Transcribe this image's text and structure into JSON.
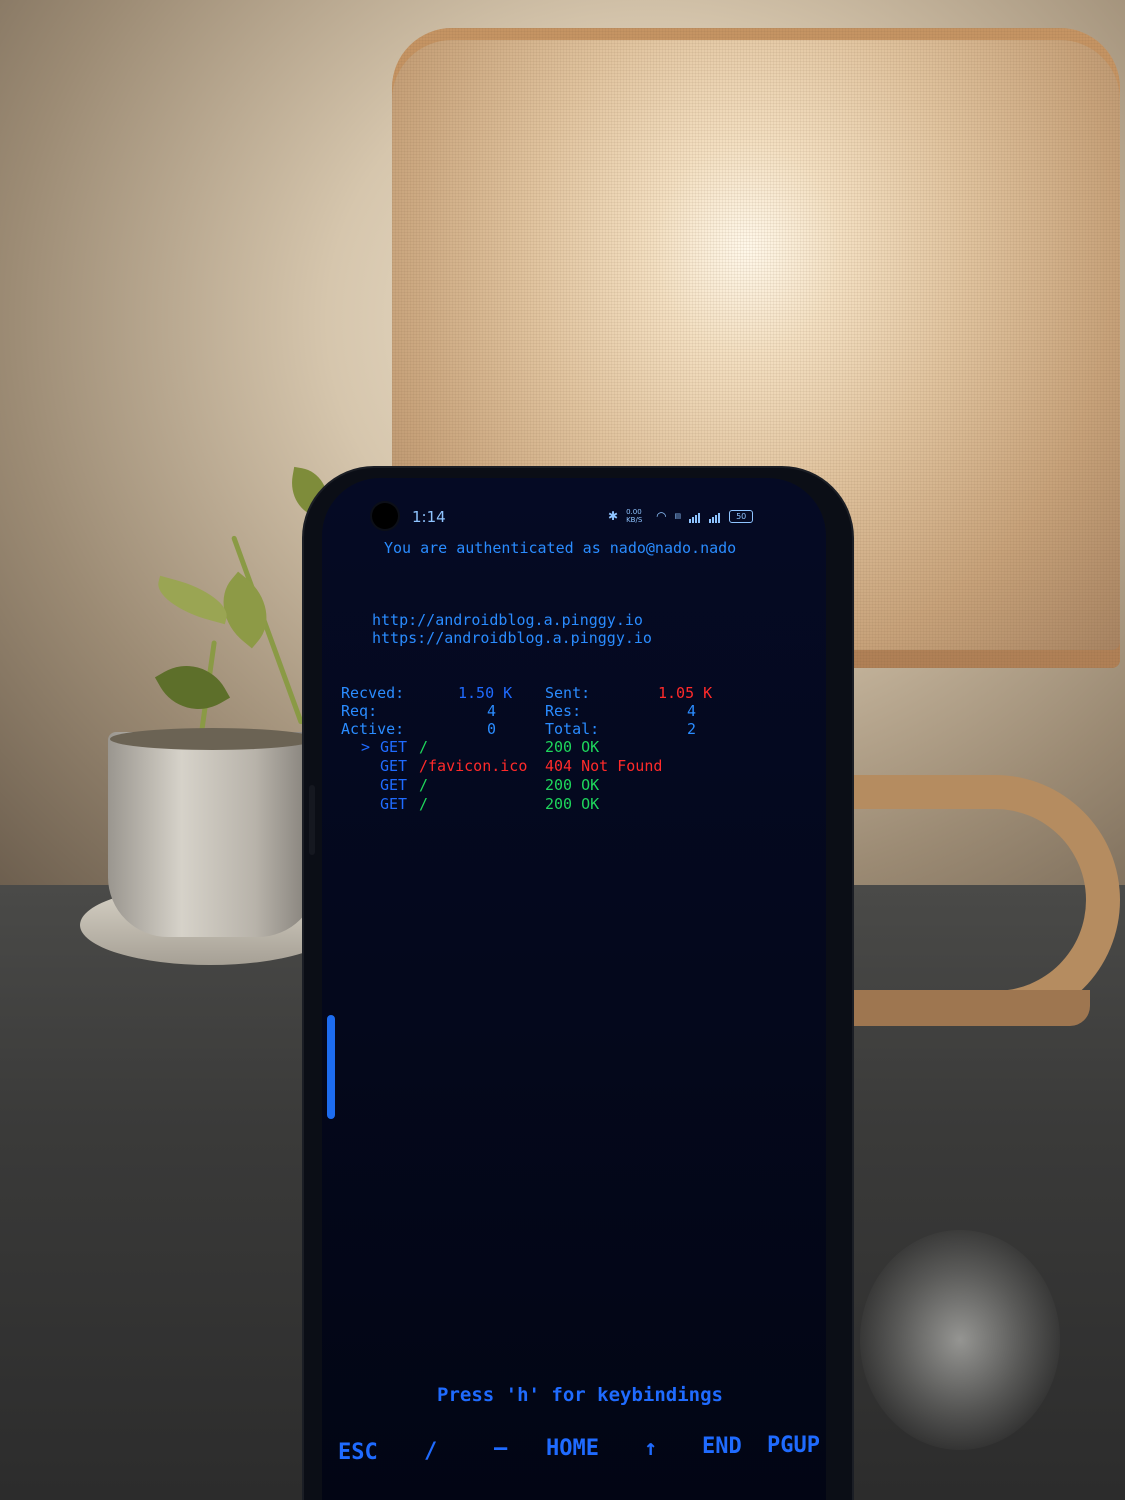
{
  "status_bar": {
    "time": "1:14",
    "speed": "0.00 KB/S",
    "battery": "50"
  },
  "terminal": {
    "auth_line": "You are authenticated as nado@nado.nado",
    "urls": [
      "http://androidblog.a.pinggy.io",
      "https://androidblog.a.pinggy.io"
    ],
    "stats": {
      "recved_label": "Recved:",
      "recved_value": "1.50 K",
      "sent_label": "Sent:",
      "sent_value": "1.05 K",
      "req_label": "Req:",
      "req_value": "4",
      "res_label": "Res:",
      "res_value": "4",
      "active_label": "Active:",
      "active_value": "0",
      "total_label": "Total:",
      "total_value": "2"
    },
    "requests": [
      {
        "marker": ">",
        "method": "GET",
        "path": "/",
        "status": "200 OK"
      },
      {
        "marker": "",
        "method": "GET",
        "path": "/favicon.ico",
        "status": "404 Not Found"
      },
      {
        "marker": "",
        "method": "GET",
        "path": "/",
        "status": "200 OK"
      },
      {
        "marker": "",
        "method": "GET",
        "path": "/",
        "status": "200 OK"
      }
    ],
    "hint": "Press 'h' for keybindings"
  },
  "extra_keys": [
    "ESC",
    "/",
    "—",
    "HOME",
    "↑",
    "END",
    "PGUP"
  ],
  "colors": {
    "text_blue": "#2a8cff",
    "error_red": "#ff2a2a",
    "ok_green": "#1ed75c",
    "screen_bg": "#04081c"
  }
}
